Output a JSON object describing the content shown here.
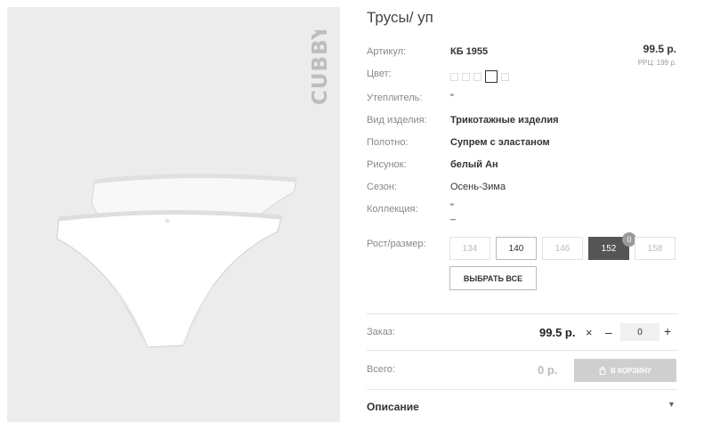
{
  "product": {
    "brand": "CUBBY",
    "title": "Трусы/ уп",
    "price": "99.5 р.",
    "rrc": "РРЦ: 199 р."
  },
  "attributes": [
    {
      "label": "Артикул:",
      "value": "КБ 1955"
    },
    {
      "label": "Цвет:",
      "value": ""
    },
    {
      "label": "Утеплитель:",
      "value": "\""
    },
    {
      "label": "Вид изделия:",
      "value": "Трикотажные изделия"
    },
    {
      "label": "Полотно:",
      "value": "Супрем с эластаном"
    },
    {
      "label": "Рисунок:",
      "value": "белый Ан"
    },
    {
      "label": "Сезон:",
      "value": "Осень-Зима"
    },
    {
      "label": "Коллекция:",
      "value": "\"\n_"
    }
  ],
  "colors": {
    "swatch_count": 5,
    "selected_index": 3
  },
  "sizes": {
    "label": "Рост/размер:",
    "items": [
      {
        "value": "134",
        "state": "disabled"
      },
      {
        "value": "140",
        "state": "available"
      },
      {
        "value": "146",
        "state": "disabled"
      },
      {
        "value": "152",
        "state": "selected",
        "badge": "0"
      },
      {
        "value": "158",
        "state": "disabled"
      }
    ],
    "select_all_label": "ВЫБРАТЬ ВСЕ"
  },
  "order": {
    "label": "Заказ:",
    "price": "99.5 р.",
    "times": "×",
    "minus": "–",
    "quantity": "0",
    "plus": "+"
  },
  "total": {
    "label": "Всего:",
    "value": "0 р.",
    "cart_label": "В КОРЗИНУ"
  },
  "description": {
    "label": "Описание"
  },
  "theme": {
    "selected_size_bg": "#555555",
    "cart_bg": "#cfcfcf",
    "photo_bg": "#ececec"
  }
}
